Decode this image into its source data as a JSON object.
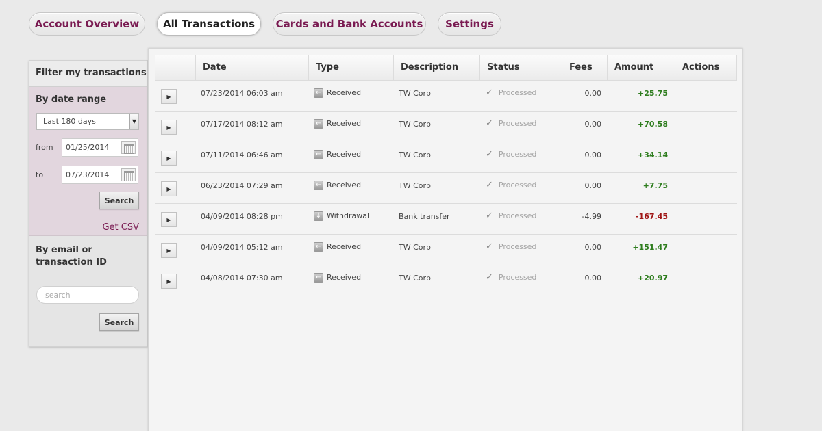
{
  "tabs": [
    "Account Overview",
    "All Transactions",
    "Cards and Bank Accounts",
    "Settings"
  ],
  "filter": {
    "title": "Filter my transactions",
    "date_range_title": "By date range",
    "range_value": "Last 180 days",
    "from_label": "from",
    "from_value": "01/25/2014",
    "to_label": "to",
    "to_value": "07/23/2014",
    "search_label": "Search",
    "csv_label": "Get CSV",
    "email_title": "By email or transaction ID",
    "search_placeholder": "search",
    "search2_label": "Search"
  },
  "table": {
    "columns": [
      "Date",
      "Type",
      "Description",
      "Status",
      "Fees",
      "Amount",
      "Actions"
    ],
    "rows": [
      {
        "date": "07/23/2014 06:03 am",
        "type": "Received",
        "description": "TW Corp",
        "status": "Processed",
        "fees": "0.00",
        "amount": "+25.75"
      },
      {
        "date": "07/17/2014 08:12 am",
        "type": "Received",
        "description": "TW Corp",
        "status": "Processed",
        "fees": "0.00",
        "amount": "+70.58"
      },
      {
        "date": "07/11/2014 06:46 am",
        "type": "Received",
        "description": "TW Corp",
        "status": "Processed",
        "fees": "0.00",
        "amount": "+34.14"
      },
      {
        "date": "06/23/2014 07:29 am",
        "type": "Received",
        "description": "TW Corp",
        "status": "Processed",
        "fees": "0.00",
        "amount": "+7.75"
      },
      {
        "date": "04/09/2014 08:28 pm",
        "type": "Withdrawal",
        "description": "Bank transfer",
        "status": "Processed",
        "fees": "-4.99",
        "amount": "-167.45"
      },
      {
        "date": "04/09/2014 05:12 am",
        "type": "Received",
        "description": "TW Corp",
        "status": "Processed",
        "fees": "0.00",
        "amount": "+151.47"
      },
      {
        "date": "04/08/2014 07:30 am",
        "type": "Received",
        "description": "TW Corp",
        "status": "Processed",
        "fees": "0.00",
        "amount": "+20.97"
      }
    ]
  },
  "icons": {
    "received": "arrow-left-icon",
    "withdrawal": "arrow-down-icon",
    "status": "checkmark-icon",
    "expand": "play-triangle-icon",
    "calendar": "calendar-icon"
  },
  "colors": {
    "brand": "#7a1b52",
    "positive": "#2e7d1e",
    "negative": "#a01616",
    "filter_bg": "#e2d6de"
  }
}
